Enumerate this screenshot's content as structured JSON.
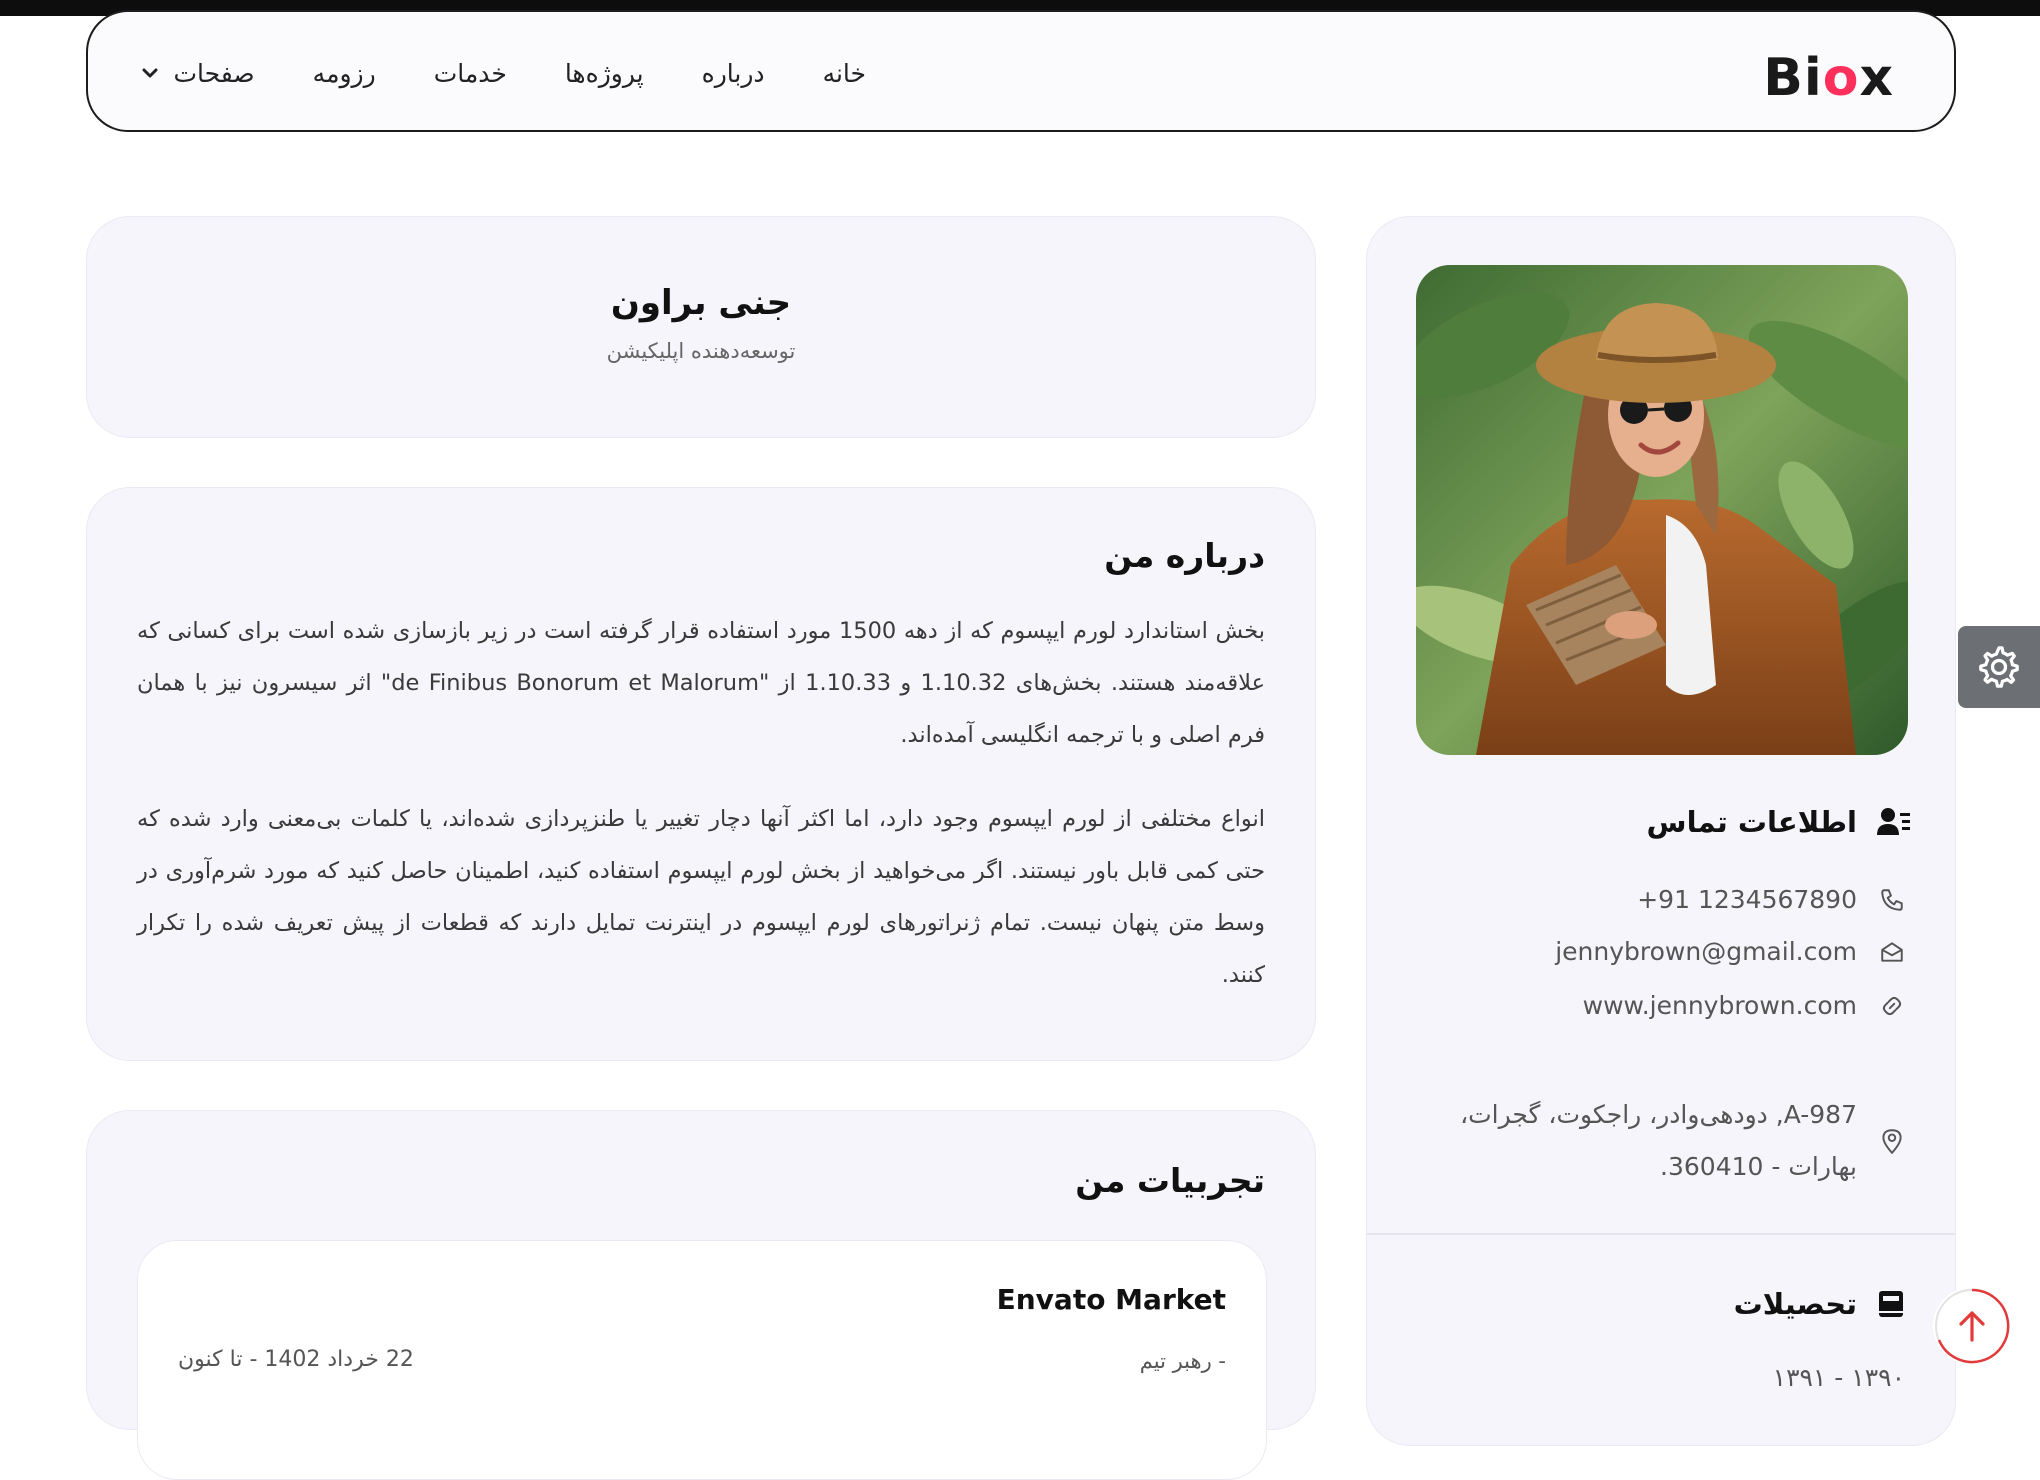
{
  "brand": {
    "logo_pre": "Bi",
    "logo_o": "o",
    "logo_post": "x",
    "accent": "#ff2f5b"
  },
  "nav": {
    "items": [
      "خانه",
      "درباره",
      "پروژه‌ها",
      "خدمات",
      "رزومه"
    ],
    "pages_label": "صفحات"
  },
  "profile": {
    "name": "جنی براون",
    "role": "توسعه‌دهنده اپلیکیشن"
  },
  "about": {
    "title": "درباره من",
    "p1": "بخش استاندارد لورم ایپسوم که از دهه 1500 مورد استفاده قرار گرفته است در زیر بازسازی شده است برای کسانی که علاقه‌مند هستند. بخش‌های 1.10.32 و 1.10.33 از \"de Finibus Bonorum et Malorum\" اثر سیسرون نیز با همان فرم اصلی و با ترجمه انگلیسی آمده‌اند.",
    "p2": "انواع مختلفی از لورم ایپسوم وجود دارد، اما اکثر آنها دچار تغییر یا طنزپردازی شده‌اند، یا کلمات بی‌معنی وارد شده که حتی کمی قابل باور نیستند. اگر می‌خواهید از بخش لورم ایپسوم استفاده کنید، اطمینان حاصل کنید که مورد شرم‌آوری در وسط متن پنهان نیست. تمام ژنراتورهای لورم ایپسوم در اینترنت تمایل دارند که قطعات از پیش تعریف شده را تکرار کنند."
  },
  "experience": {
    "title": "تجربیات من",
    "jobs": [
      {
        "company": "Envato Market",
        "position": "- رهبر تیم",
        "date": "22 خرداد 1402 - تا کنون"
      }
    ]
  },
  "contact": {
    "title": "اطلاعات تماس",
    "phone": "+91 1234567890",
    "email": "jennybrown@gmail.com",
    "website": "www.jennybrown.com",
    "address_line1": "A-987, دودهی‌وادر، راجکوت، گجرات،",
    "address_line2": "بهارات - 360410."
  },
  "education": {
    "title": "تحصیلات",
    "years": "۱۳۹۰ - ۱۳۹۱"
  },
  "icons": {
    "settings": "gear-icon",
    "scroll_top": "arrow-up-icon",
    "contact": "user-card-icon",
    "phone": "phone-icon",
    "email": "envelope-open-icon",
    "website": "link-icon",
    "address": "map-pin-icon",
    "education": "book-icon",
    "dropdown": "chevron-down-icon"
  }
}
